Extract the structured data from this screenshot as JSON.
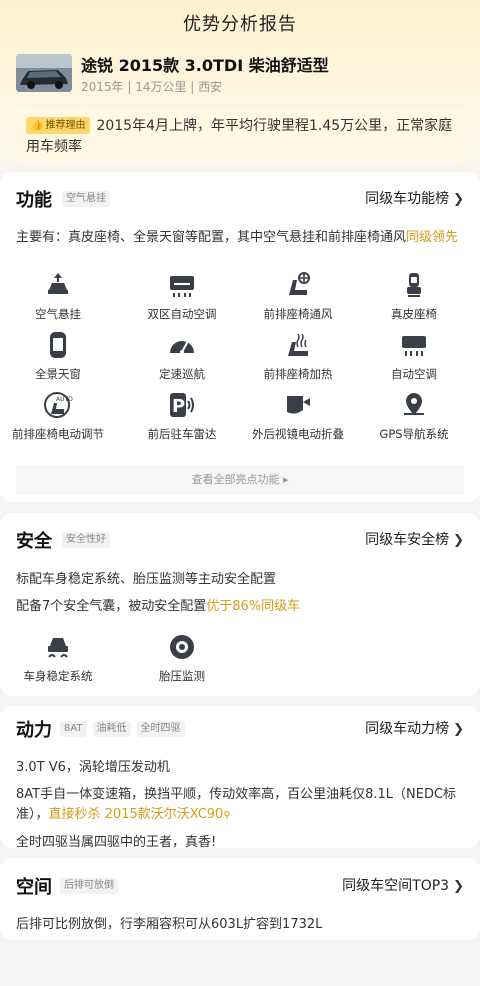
{
  "page_title": "优势分析报告",
  "car": {
    "name": "途锐 2015款 3.0TDI 柴油舒适型",
    "meta": "2015年 | 14万公里 | 西安"
  },
  "reason": {
    "tag": "推荐理由",
    "text": "2015年4月上牌，年平均行驶里程1.45万公里，正常家庭用车频率"
  },
  "features": {
    "title": "功能",
    "tag": "空气悬挂",
    "rank_link": "同级车功能榜",
    "desc_prefix": "主要有：真皮座椅、全景天窗等配置，其中空气悬挂和前排座椅通风",
    "desc_highlight": "同级领先",
    "items": [
      {
        "label": "空气悬挂",
        "icon": "air-suspension-icon"
      },
      {
        "label": "双区自动空调",
        "icon": "dual-zone-ac-icon"
      },
      {
        "label": "前排座椅通风",
        "icon": "seat-ventilation-icon"
      },
      {
        "label": "真皮座椅",
        "icon": "leather-seat-icon"
      },
      {
        "label": "全景天窗",
        "icon": "panoramic-sunroof-icon"
      },
      {
        "label": "定速巡航",
        "icon": "cruise-control-icon"
      },
      {
        "label": "前排座椅加热",
        "icon": "seat-heating-icon"
      },
      {
        "label": "自动空调",
        "icon": "auto-ac-icon"
      },
      {
        "label": "前排座椅电动调节",
        "icon": "power-seat-icon"
      },
      {
        "label": "前后驻车雷达",
        "icon": "parking-radar-icon"
      },
      {
        "label": "外后视镜电动折叠",
        "icon": "folding-mirror-icon"
      },
      {
        "label": "GPS导航系统",
        "icon": "gps-icon"
      }
    ],
    "view_all": "查看全部亮点功能 ▸"
  },
  "safety": {
    "title": "安全",
    "tag": "安全性好",
    "rank_link": "同级车安全榜",
    "line1": "标配车身稳定系统、胎压监测等主动安全配置",
    "line2_prefix": "配备7个安全气囊，被动安全配置",
    "line2_highlight": "优于86%同级车",
    "items": [
      {
        "label": "车身稳定系统",
        "icon": "stability-control-icon"
      },
      {
        "label": "胎压监测",
        "icon": "tire-pressure-icon"
      }
    ]
  },
  "power": {
    "title": "动力",
    "tags": [
      "8AT",
      "油耗低",
      "全时四驱"
    ],
    "rank_link": "同级车动力榜",
    "line1": "3.0T V6，涡轮增压发动机",
    "line2_prefix": "8AT手自一体变速箱，换挡平顺，传动效率高，百公里油耗仅8.1L（NEDC标准），",
    "line2_highlight": "直接秒杀 2015款沃尔沃XC90",
    "line3": "全时四驱当属四驱中的王者，真香!"
  },
  "space": {
    "title": "空间",
    "tag": "后排可放倒",
    "rank_link": "同级车空间TOP3",
    "line1": "后排可比例放倒，行李厢容积可从603L扩容到1732L"
  },
  "colors": {
    "accent": "#d79b1a",
    "tag_bg": "#ffd86a",
    "header_bg": "#fdf1cf"
  }
}
